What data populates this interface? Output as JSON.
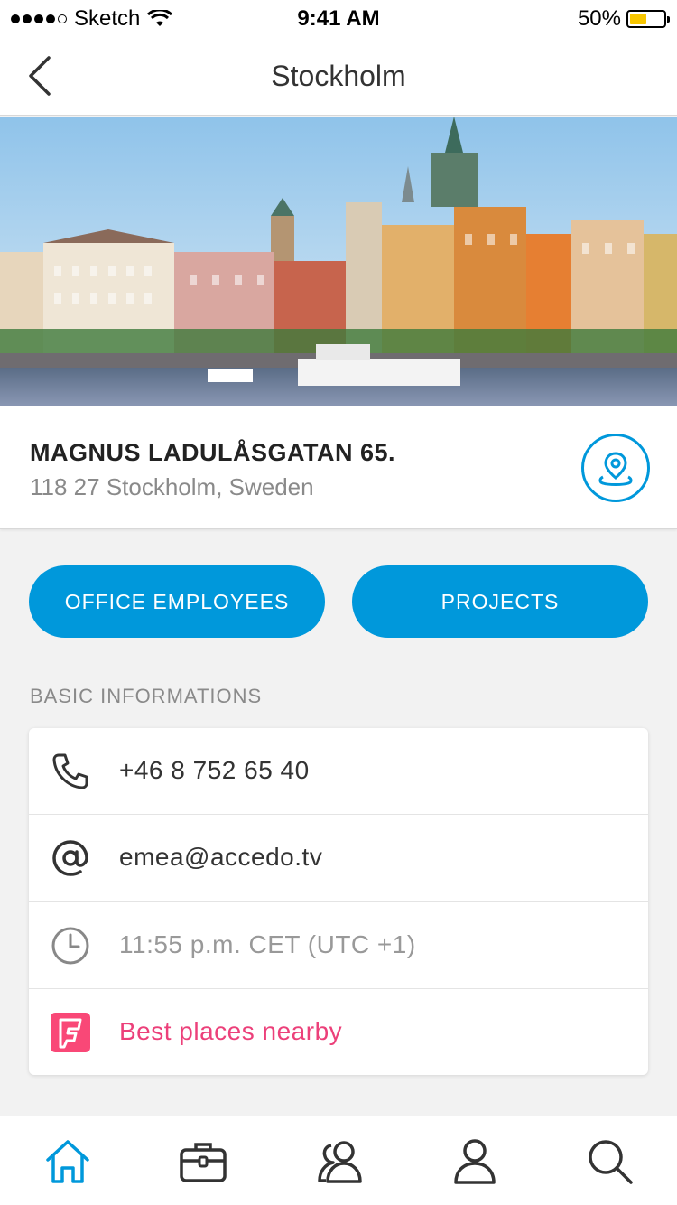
{
  "status_bar": {
    "carrier": "Sketch",
    "time": "9:41 AM",
    "battery": "50%",
    "battery_level": 0.5
  },
  "nav": {
    "title": "Stockholm",
    "back_icon": "chevron-left-icon"
  },
  "address": {
    "street": "MAGNUS LADULÅSGATAN 65.",
    "city": "118 27 Stockholm, Sweden",
    "map_icon": "location-pin-icon"
  },
  "actions": {
    "employees_label": "OFFICE EMPLOYEES",
    "projects_label": "PROJECTS"
  },
  "basic_info": {
    "heading": "BASIC INFORMATIONS",
    "phone": "+46 8 752 65 40",
    "email": "emea@accedo.tv",
    "local_time": "11:55 p.m. CET (UTC +1)",
    "nearby": "Best places nearby"
  },
  "tabs": [
    {
      "icon": "home-icon",
      "active": true
    },
    {
      "icon": "briefcase-icon",
      "active": false
    },
    {
      "icon": "people-icon",
      "active": false
    },
    {
      "icon": "person-icon",
      "active": false
    },
    {
      "icon": "search-icon",
      "active": false
    }
  ],
  "colors": {
    "accent": "#0098db",
    "foursquare": "#f94877",
    "nearby_text": "#ec407a"
  }
}
